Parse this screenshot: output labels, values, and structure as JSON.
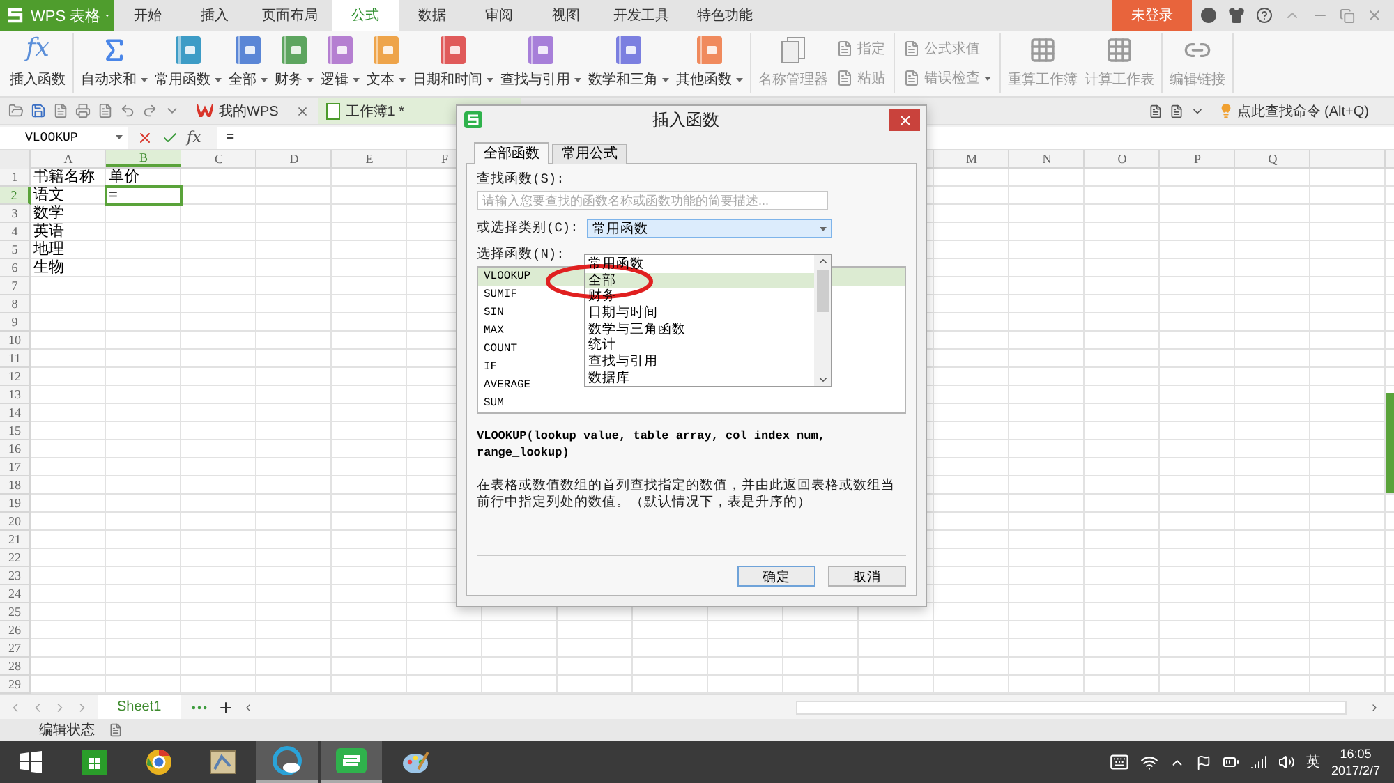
{
  "title_bar": {
    "app_button": "WPS 表格",
    "menu_tabs": [
      {
        "label": "开始",
        "selected": false
      },
      {
        "label": "插入",
        "selected": false
      },
      {
        "label": "页面布局",
        "selected": false
      },
      {
        "label": "公式",
        "selected": true
      },
      {
        "label": "数据",
        "selected": false
      },
      {
        "label": "审阅",
        "selected": false
      },
      {
        "label": "视图",
        "selected": false
      },
      {
        "label": "开发工具",
        "selected": false
      },
      {
        "label": "特色功能",
        "selected": false
      }
    ],
    "login": "未登录"
  },
  "ribbon": {
    "groups": [
      {
        "items": [
          {
            "kind": "fx",
            "icon_text": "fx",
            "label": "插入函数",
            "dropdown": false,
            "disabled": false,
            "color": "#5b8fd9"
          }
        ]
      },
      {
        "items": [
          {
            "kind": "sigma",
            "label": "自动求和",
            "dropdown": true,
            "disabled": false,
            "color": "#4a86e8"
          },
          {
            "kind": "book",
            "label": "常用函数",
            "dropdown": true,
            "disabled": false,
            "color": "#3d9cc6"
          },
          {
            "kind": "book",
            "label": "全部",
            "dropdown": true,
            "disabled": false,
            "color": "#5a86d6"
          },
          {
            "kind": "book",
            "label": "财务",
            "dropdown": true,
            "disabled": false,
            "color": "#5da55f"
          },
          {
            "kind": "book",
            "label": "逻辑",
            "dropdown": true,
            "disabled": false,
            "color": "#b57fd1"
          },
          {
            "kind": "book",
            "label": "文本",
            "dropdown": true,
            "disabled": false,
            "color": "#eea44a"
          },
          {
            "kind": "book",
            "label": "日期和时间",
            "dropdown": true,
            "disabled": false,
            "color": "#e05a5a"
          },
          {
            "kind": "book",
            "label": "查找与引用",
            "dropdown": true,
            "disabled": false,
            "color": "#a77fd9"
          },
          {
            "kind": "book",
            "label": "数学和三角",
            "dropdown": true,
            "disabled": false,
            "color": "#7b7fe0"
          },
          {
            "kind": "book",
            "label": "其他函数",
            "dropdown": true,
            "disabled": false,
            "color": "#f08a5d"
          }
        ]
      },
      {
        "items": [
          {
            "kind": "doc",
            "label": "名称管理器",
            "dropdown": false,
            "disabled": true,
            "color": "#9a9a9a"
          },
          {
            "kind": "small",
            "label": "指定",
            "dropdown": false,
            "disabled": true,
            "color": "#9a9a9a"
          },
          {
            "kind": "small",
            "label": "粘贴",
            "dropdown": false,
            "disabled": true,
            "color": "#9a9a9a"
          }
        ]
      },
      {
        "items": [
          {
            "kind": "small",
            "label": "公式求值",
            "dropdown": false,
            "disabled": true,
            "color": "#9a9a9a"
          },
          {
            "kind": "small",
            "label": "错误检查",
            "dropdown": true,
            "disabled": true,
            "color": "#9a9a9a"
          }
        ]
      },
      {
        "items": [
          {
            "kind": "sheet",
            "label": "重算工作簿",
            "dropdown": false,
            "disabled": true,
            "color": "#9a9a9a"
          },
          {
            "kind": "sheet",
            "label": "计算工作表",
            "dropdown": false,
            "disabled": true,
            "color": "#9a9a9a"
          }
        ]
      },
      {
        "items": [
          {
            "kind": "link",
            "label": "编辑链接",
            "dropdown": false,
            "disabled": true,
            "color": "#9a9a9a"
          }
        ]
      }
    ]
  },
  "doc_tabs": [
    {
      "label": "我的WPS",
      "kind": "home",
      "selected": false
    },
    {
      "label": "工作簿1 *",
      "kind": "sheet",
      "selected": true
    }
  ],
  "command_search": "点此查找命令 (Alt+Q)",
  "formula_bar": {
    "name_box": "VLOOKUP",
    "icon_text": "fx",
    "formula": "="
  },
  "sheet": {
    "columns_left": [
      {
        "label": "A",
        "selected": false
      },
      {
        "label": "B",
        "selected": true
      },
      {
        "label": "C",
        "selected": false
      },
      {
        "label": "D",
        "selected": false
      },
      {
        "label": "E",
        "selected": false
      },
      {
        "label": "F",
        "selected": false
      }
    ],
    "columns_right": [
      {
        "label": "M",
        "selected": false
      },
      {
        "label": "N",
        "selected": false
      },
      {
        "label": "O",
        "selected": false
      },
      {
        "label": "P",
        "selected": false
      },
      {
        "label": "Q",
        "selected": false
      }
    ],
    "rows": [
      {
        "label": "1",
        "selected": false,
        "cells": [
          {
            "text": "书籍名称",
            "active": false
          },
          {
            "text": "单价",
            "active": false
          }
        ]
      },
      {
        "label": "2",
        "selected": true,
        "cells": [
          {
            "text": "语文",
            "active": false
          },
          {
            "text": "=",
            "active": true
          }
        ]
      },
      {
        "label": "3",
        "selected": false,
        "cells": [
          {
            "text": "数学",
            "active": false
          }
        ]
      },
      {
        "label": "4",
        "selected": false,
        "cells": [
          {
            "text": "英语",
            "active": false
          }
        ]
      },
      {
        "label": "5",
        "selected": false,
        "cells": [
          {
            "text": "地理",
            "active": false
          }
        ]
      },
      {
        "label": "6",
        "selected": false,
        "cells": [
          {
            "text": "生物",
            "active": false
          }
        ]
      },
      {
        "label": "7",
        "selected": false
      },
      {
        "label": "8",
        "selected": false
      },
      {
        "label": "9",
        "selected": false
      },
      {
        "label": "10",
        "selected": false
      },
      {
        "label": "11",
        "selected": false
      },
      {
        "label": "12",
        "selected": false
      },
      {
        "label": "13",
        "selected": false
      },
      {
        "label": "14",
        "selected": false
      },
      {
        "label": "15",
        "selected": false
      },
      {
        "label": "16",
        "selected": false
      },
      {
        "label": "17",
        "selected": false
      },
      {
        "label": "18",
        "selected": false
      },
      {
        "label": "19",
        "selected": false
      },
      {
        "label": "20",
        "selected": false
      },
      {
        "label": "21",
        "selected": false
      },
      {
        "label": "22",
        "selected": false
      },
      {
        "label": "23",
        "selected": false
      },
      {
        "label": "24",
        "selected": false
      },
      {
        "label": "25",
        "selected": false
      },
      {
        "label": "26",
        "selected": false
      },
      {
        "label": "27",
        "selected": false
      },
      {
        "label": "28",
        "selected": false
      },
      {
        "label": "29",
        "selected": false
      }
    ]
  },
  "sheet_tabs": [
    {
      "label": "Sheet1",
      "selected": true
    }
  ],
  "status_bar": {
    "mode": "编辑状态"
  },
  "dialog": {
    "title": "插入函数",
    "tabs": [
      {
        "label": "全部函数",
        "selected": true
      },
      {
        "label": "常用公式",
        "selected": false
      }
    ],
    "search_label": "查找函数(S):",
    "search": {
      "placeholder": "请输入您要查找的函数名称或函数功能的简要描述..."
    },
    "category_label": "或选择类别(C):",
    "category": {
      "value": "常用函数",
      "expanded": true
    },
    "category_options": [
      {
        "label": "常用函数",
        "selected": false
      },
      {
        "label": "全部",
        "selected": true
      },
      {
        "label": "财务",
        "selected": false
      },
      {
        "label": "日期与时间",
        "selected": false
      },
      {
        "label": "数学与三角函数",
        "selected": false
      },
      {
        "label": "统计",
        "selected": false
      },
      {
        "label": "查找与引用",
        "selected": false
      },
      {
        "label": "数据库",
        "selected": false
      }
    ],
    "function_label": "选择函数(N):",
    "functions": [
      {
        "name": "VLOOKUP",
        "selected": true
      },
      {
        "name": "SUMIF",
        "selected": false
      },
      {
        "name": "SIN",
        "selected": false
      },
      {
        "name": "MAX",
        "selected": false
      },
      {
        "name": "COUNT",
        "selected": false
      },
      {
        "name": "IF",
        "selected": false
      },
      {
        "name": "AVERAGE",
        "selected": false
      },
      {
        "name": "SUM",
        "selected": false
      }
    ],
    "signature": "VLOOKUP(lookup_value, table_array, col_index_num, range_lookup)",
    "description": "在表格或数值数组的首列查找指定的数值，并由此返回表格或数组当前行中指定列处的数值。（默认情况下，表是升序的）",
    "buttons": [
      {
        "label": "确定",
        "primary": true
      },
      {
        "label": "取消",
        "primary": false
      }
    ]
  },
  "taskbar": {
    "apps": [
      {
        "kind": "store",
        "running": false
      },
      {
        "kind": "chrome",
        "running": false
      },
      {
        "kind": "maps",
        "running": false
      },
      {
        "kind": "browser",
        "running": true
      },
      {
        "kind": "wps",
        "running": true
      },
      {
        "kind": "paint",
        "running": false
      }
    ],
    "ime": "英",
    "time": "16:05",
    "date": "2017/2/7"
  }
}
